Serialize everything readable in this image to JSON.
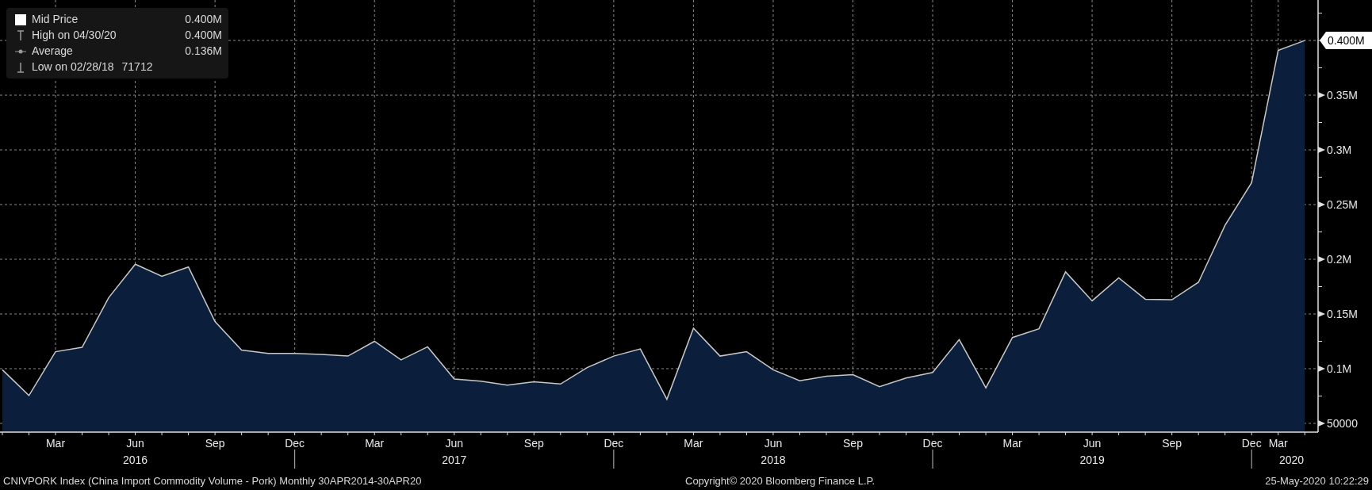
{
  "legend": {
    "items": [
      {
        "kind": "series",
        "label": "Mid Price",
        "value": "0.400M"
      },
      {
        "kind": "high",
        "label": "High on 04/30/20",
        "value": "0.400M"
      },
      {
        "kind": "average",
        "label": "Average",
        "value": "0.136M"
      },
      {
        "kind": "low",
        "label": "Low on 02/28/18",
        "value": "71712"
      }
    ]
  },
  "chart_data": {
    "type": "area",
    "categories": [
      null,
      null,
      "Mar",
      null,
      null,
      "Jun",
      null,
      null,
      "Sep",
      null,
      null,
      "Dec",
      null,
      null,
      "Mar",
      null,
      null,
      "Jun",
      null,
      null,
      "Sep",
      null,
      null,
      "Dec",
      null,
      null,
      "Mar",
      null,
      null,
      "Jun",
      null,
      null,
      "Sep",
      null,
      null,
      "Dec",
      null,
      null,
      "Mar",
      null,
      null,
      "Jun",
      null,
      null,
      "Sep",
      null,
      null,
      "Dec",
      "Mar",
      null
    ],
    "grid": true,
    "series": [
      {
        "color": "#c8c8c8",
        "values": [
          99000,
          75500,
          115500,
          119500,
          165000,
          195500,
          184500,
          193000,
          143000,
          117000,
          114000,
          114000,
          113000,
          111500,
          125000,
          108000,
          120000,
          90500,
          88500,
          85000,
          88000,
          86000,
          101000,
          111500,
          118000,
          72000,
          137000,
          111500,
          115500,
          99000,
          89000,
          93000,
          94500,
          83500,
          91500,
          96500,
          126500,
          82500,
          128500,
          136500,
          188500,
          162000,
          183000,
          163500,
          163000,
          179000,
          231000,
          270000,
          391000,
          400000
        ]
      }
    ],
    "ylim": [
      42000,
      437000
    ],
    "yticks": [
      {
        "value": 50000,
        "label": "50000"
      },
      {
        "value": 100000,
        "label": "0.1M"
      },
      {
        "value": 150000,
        "label": "0.15M"
      },
      {
        "value": 200000,
        "label": "0.2M"
      },
      {
        "value": 250000,
        "label": "0.25M"
      },
      {
        "value": 300000,
        "label": "0.3M"
      },
      {
        "value": 350000,
        "label": "0.35M"
      }
    ],
    "annotations": [
      "0.400M"
    ]
  },
  "year_labels": [
    "2016",
    "2017",
    "2018",
    "2019",
    "2020"
  ],
  "footer": {
    "description": "CNIVPORK Index (China Import Commodity Volume - Pork)  Monthly 30APR2014-30APR20",
    "copyright": "Copyright© 2020 Bloomberg Finance L.P.",
    "timestamp": "25-May-2020 10:22:29"
  }
}
